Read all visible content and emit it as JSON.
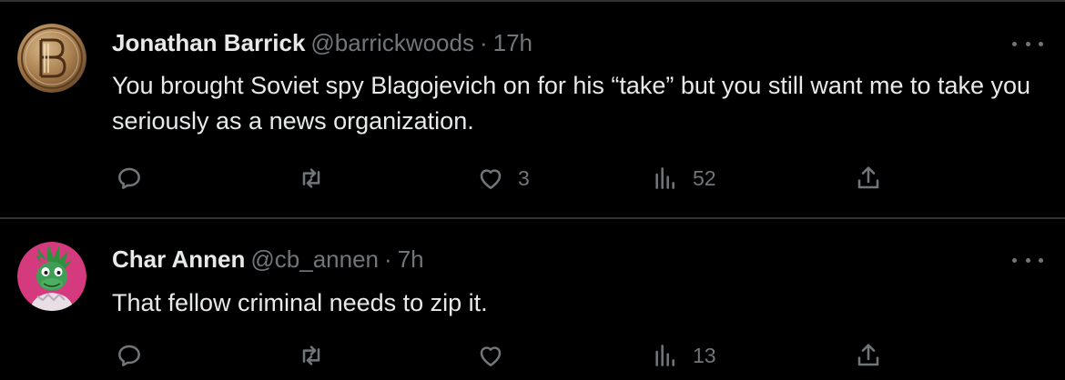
{
  "tweets": [
    {
      "display_name": "Jonathan Barrick",
      "handle": "@barrickwoods",
      "separator": "·",
      "time": "17h",
      "text": "You brought Soviet spy Blagojevich on for his “take” but you still want me to take you seriously as a news organization.",
      "likes": "3",
      "views": "52",
      "avatar_icon": "coin-monogram-avatar"
    },
    {
      "display_name": "Char Annen",
      "handle": "@cb_annen",
      "separator": "·",
      "time": "7h",
      "text": "That fellow criminal needs to zip it.",
      "views": "13",
      "avatar_icon": "dinosaur-character-avatar"
    }
  ],
  "colors": {
    "background": "#000000",
    "primary_text": "#e7e9ea",
    "secondary_text": "#71767b",
    "divider": "#2f3336"
  },
  "icons": [
    "reply-icon",
    "retweet-icon",
    "like-icon",
    "views-icon",
    "share-icon",
    "more-icon"
  ]
}
